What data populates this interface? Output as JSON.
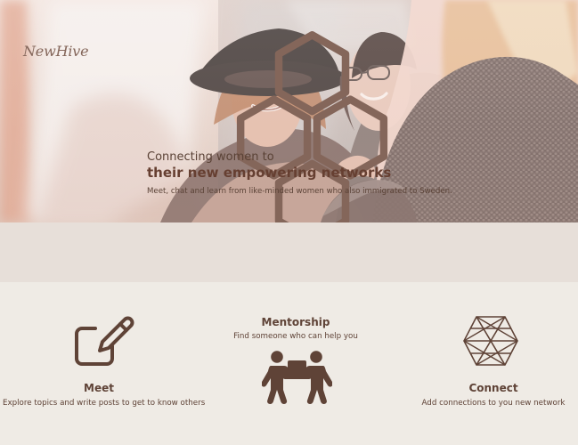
{
  "brand": {
    "logo_text": "NewHive"
  },
  "hero": {
    "headline_line_1": "Connecting women to",
    "headline_line_2": "their new empowering networks",
    "subtext": "Meet, chat and learn from like-minded women who also immigrated to Sweden."
  },
  "features": {
    "items": [
      {
        "title": "Meet",
        "description": "Explore topics and write posts to get to know others",
        "icon": "edit-icon"
      },
      {
        "title": "Mentorship",
        "description": "Find someone who can help you",
        "icon": "mentorship-icon"
      },
      {
        "title": "Connect",
        "description": "Add connections to you new network",
        "icon": "network-icon"
      }
    ]
  },
  "colors": {
    "brand": "#5f4337",
    "hero_overlay": "#f3ece7",
    "band": "#e7dfd9",
    "background": "#efebe5"
  }
}
